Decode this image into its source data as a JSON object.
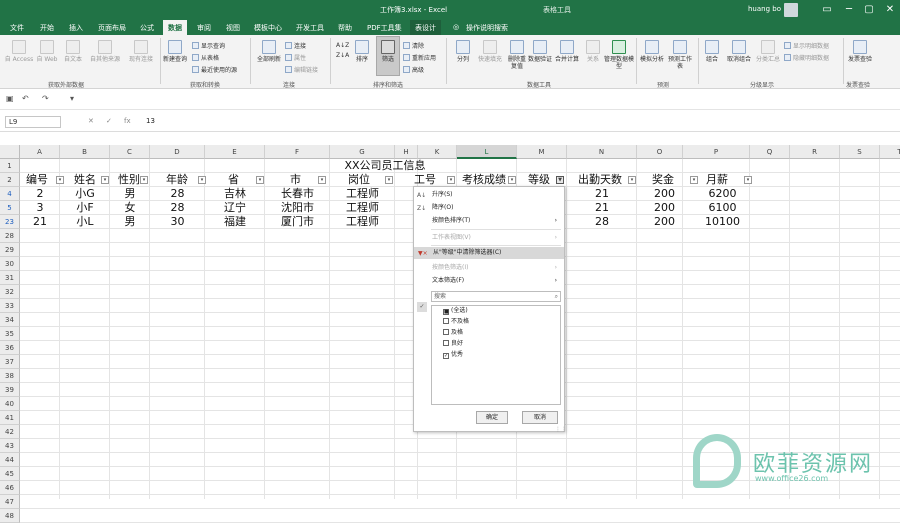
{
  "titlebar": {
    "file_title": "工作簿3.xlsx - Excel",
    "context_tab": "表格工具",
    "user": "huang bo",
    "minimize": "─",
    "restore": "▢",
    "close": "✕"
  },
  "tabs": [
    "文件",
    "开始",
    "插入",
    "页面布局",
    "公式",
    "数据",
    "审阅",
    "视图",
    "模板中心",
    "开发工具",
    "帮助",
    "PDF工具集",
    "表设计",
    "操作说明搜索"
  ],
  "ribbon": {
    "get_external": {
      "group": "获取外部数据",
      "items": [
        "自 Access",
        "自 Web",
        "自文本",
        "自其他来源",
        "现有连接"
      ]
    },
    "get_transform": {
      "group": "获取和转换",
      "new_query": "新建查询",
      "show_query": "显示查询",
      "from_table": "从表格",
      "recent": "最近使用的源"
    },
    "connections": {
      "group": "连接",
      "refresh_all": "全部刷新",
      "connect": "连接",
      "props": "属性",
      "edit_links": "编辑链接"
    },
    "sort_filter": {
      "group": "排序和筛选",
      "sort": "排序",
      "filter": "筛选",
      "clear": "清除",
      "reapply": "重新应用",
      "advanced": "高级"
    },
    "data_tools": {
      "group": "数据工具",
      "items": [
        "分列",
        "快速填充",
        "删除重复值",
        "数据验证",
        "合并计算",
        "关系",
        "管理数据模型"
      ]
    },
    "forecast": {
      "group": "预测",
      "items": [
        "模拟分析",
        "预测工作表"
      ]
    },
    "outline": {
      "group": "分级显示",
      "items": [
        "组合",
        "取消组合",
        "分类汇总"
      ],
      "show_detail": "显示明细数据",
      "hide_detail": "隐藏明细数据"
    },
    "invoice": {
      "group": "发票查验",
      "label": "发票查验"
    }
  },
  "formula_bar": {
    "name_box": "L9",
    "cancel": "✕",
    "enter": "✓",
    "fx": "fx",
    "value": "13"
  },
  "columns": [
    "A",
    "B",
    "C",
    "D",
    "E",
    "F",
    "G",
    "H",
    "K",
    "L",
    "M",
    "N",
    "O",
    "P",
    "Q",
    "R",
    "S",
    "T"
  ],
  "rows": [
    "1",
    "2",
    "4",
    "5",
    "23",
    "28",
    "29",
    "30",
    "31",
    "32",
    "33",
    "34",
    "35",
    "36",
    "37",
    "38",
    "39",
    "40",
    "41",
    "42",
    "43",
    "44",
    "45",
    "46",
    "47",
    "48"
  ],
  "sheet": {
    "title": "XX公司员工信息",
    "headers": [
      "编号",
      "姓名",
      "性别",
      "年龄",
      "省",
      "市",
      "岗位",
      "工号",
      "考核成绩",
      "等级",
      "出勤天数",
      "奖金",
      "月薪"
    ],
    "data": [
      [
        "2",
        "小G",
        "男",
        "28",
        "吉林",
        "长春市",
        "工程师",
        "",
        "",
        "",
        "21",
        "200",
        "6200"
      ],
      [
        "3",
        "小F",
        "女",
        "28",
        "辽宁",
        "沈阳市",
        "工程师",
        "",
        "",
        "",
        "21",
        "200",
        "6100"
      ],
      [
        "21",
        "小L",
        "男",
        "30",
        "福建",
        "厦门市",
        "工程师",
        "",
        "",
        "",
        "28",
        "200",
        "10100"
      ]
    ]
  },
  "filter_menu": {
    "sort_asc": "升序(S)",
    "sort_desc": "降序(O)",
    "sort_by_color": "按颜色排序(T)",
    "sheet_view": "工作表视图(V)",
    "clear_filter": "从\"等级\"中清除筛选器(C)",
    "filter_by_color": "按颜色筛选(I)",
    "text_filter": "文本筛选(F)",
    "search": "搜索",
    "options": [
      {
        "label": "(全选)",
        "state": "partial"
      },
      {
        "label": "不及格",
        "state": "unchecked"
      },
      {
        "label": "及格",
        "state": "unchecked"
      },
      {
        "label": "良好",
        "state": "unchecked"
      },
      {
        "label": "优秀",
        "state": "checked"
      }
    ],
    "ok": "确定",
    "cancel": "取消"
  },
  "watermark": {
    "text": "欧菲资源网",
    "url": "www.office26.com"
  }
}
